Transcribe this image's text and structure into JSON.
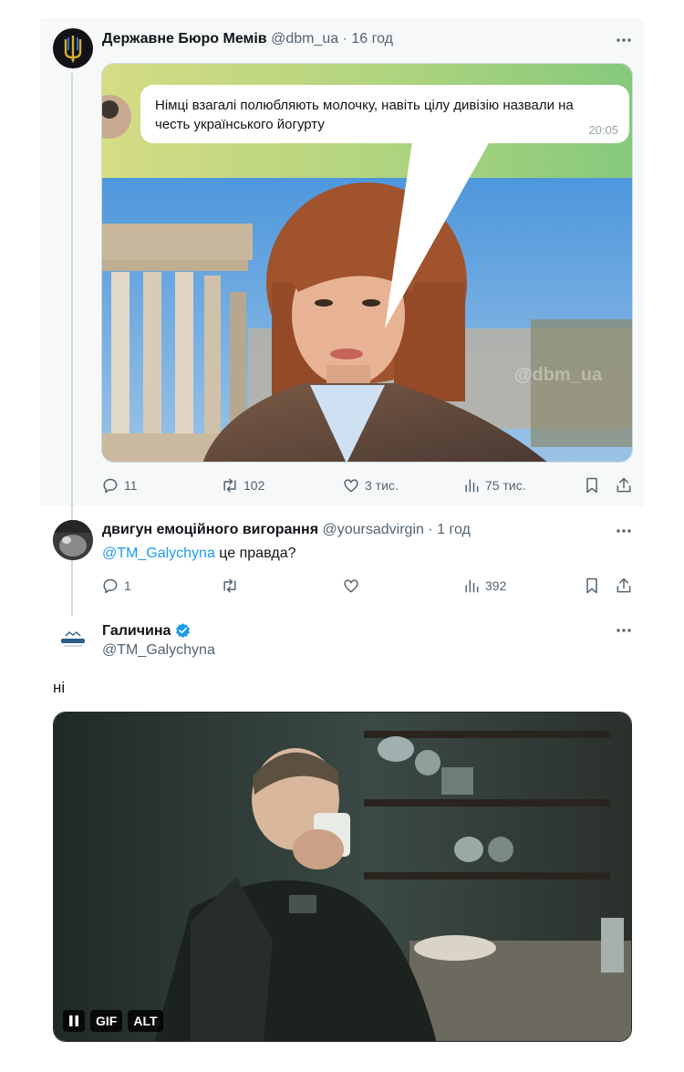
{
  "tweet1": {
    "author_name": "Державне Бюро Мемів",
    "author_handle": "@dbm_ua",
    "time": "· 16 год",
    "image": {
      "message": "Німці взагалі полюбляють молочку, навіть цілу дивізію назвали на честь українського йогурту",
      "message_time": "20:05",
      "watermark": "@dbm_ua"
    },
    "replies": "11",
    "retweets": "102",
    "likes": "3 тис.",
    "views": "75 тис."
  },
  "tweet2": {
    "author_name": "двигун емоційного вигорання",
    "author_handle": "@yoursadvirgin",
    "time": "· 1 год",
    "mention": "@TM_Galychyna",
    "text": " це правда?",
    "replies": "1",
    "retweets": "",
    "likes": "",
    "views": "392"
  },
  "tweet3": {
    "author_name": "Галичина",
    "author_handle": "@TM_Galychyna",
    "avatar_label": "Галичина",
    "text": "ні",
    "gif_badge": "GIF",
    "alt_badge": "ALT"
  },
  "colors": {
    "accent": "#1d9bf0",
    "secondary_text": "#536471",
    "thread_background": "#f7f9f9"
  }
}
